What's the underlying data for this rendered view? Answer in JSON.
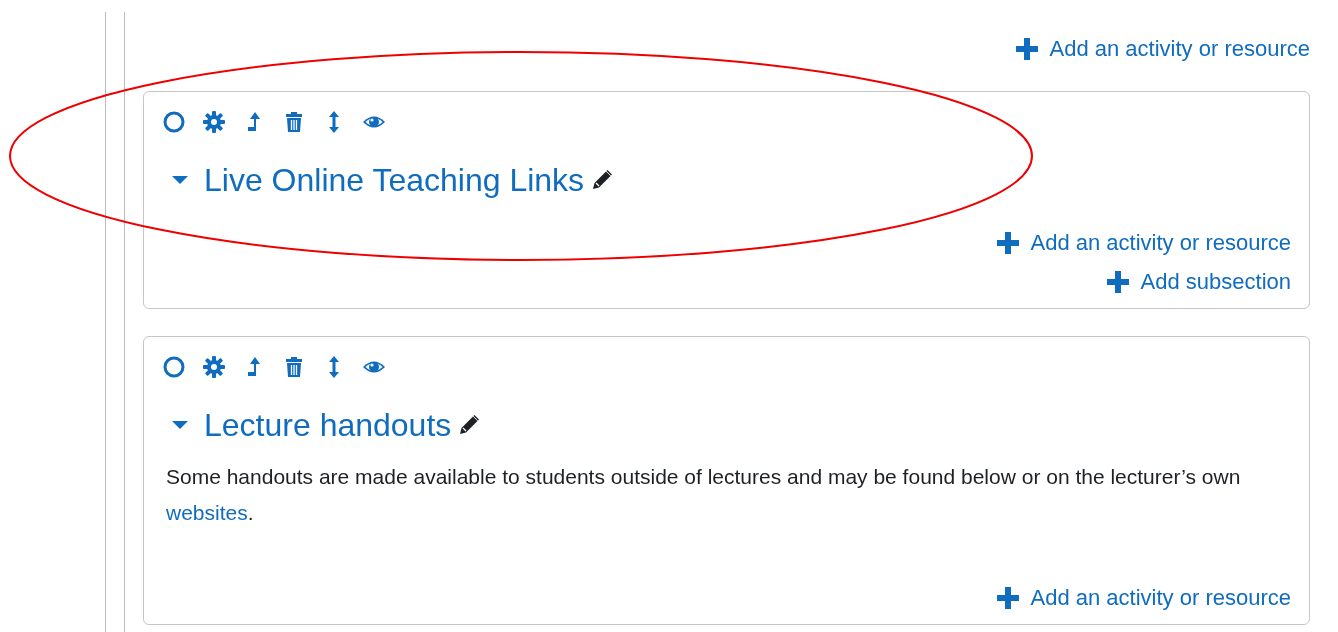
{
  "top_link": "Add an activity or resource",
  "sections": [
    {
      "title": "Live Online Teaching Links",
      "expanded": true,
      "highlighted": true,
      "links": [
        {
          "label": "Add an activity or resource"
        },
        {
          "label": "Add subsection"
        }
      ]
    },
    {
      "title": "Lecture handouts",
      "expanded": true,
      "highlighted": false,
      "description": "Some handouts are made available to students outside of lectures and may be found below or on the lecturer’s own ",
      "description_link": "websites",
      "description_end": ".",
      "links": [
        {
          "label": "Add an activity or resource"
        }
      ]
    }
  ]
}
